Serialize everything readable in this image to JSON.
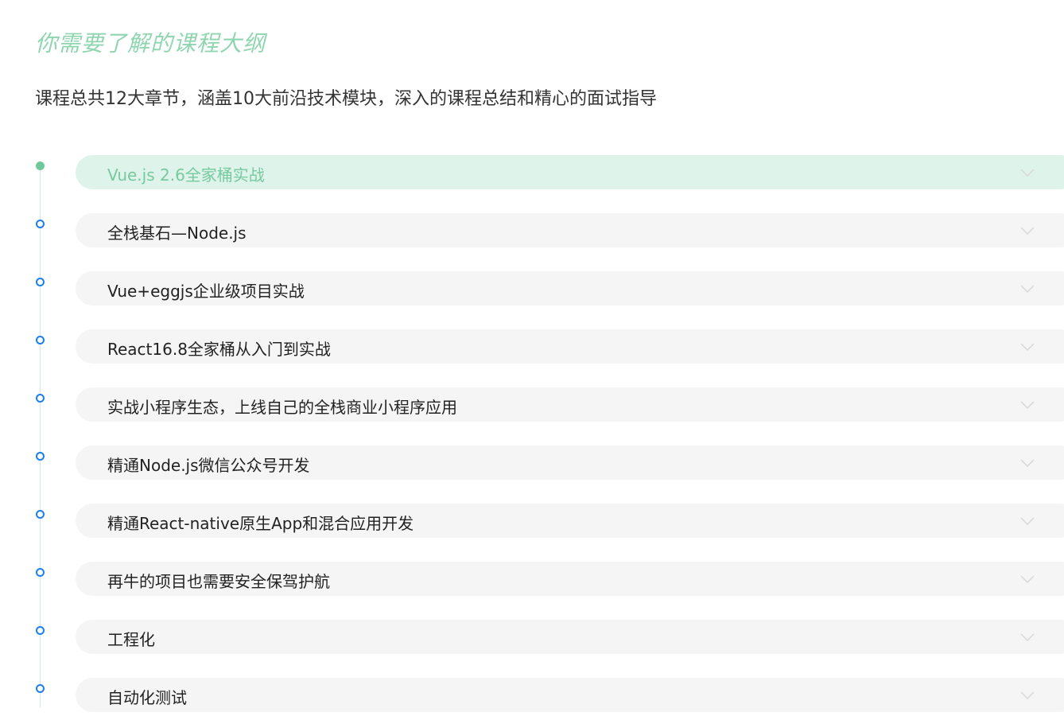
{
  "header": {
    "title": "你需要了解的课程大纲",
    "subtitle": "课程总共12大章节，涵盖10大前沿技术模块，深入的课程总结和精心的面试指导"
  },
  "chapters": [
    {
      "label": "Vue.js 2.6全家桶实战",
      "active": true
    },
    {
      "label": "全栈基石—Node.js",
      "active": false
    },
    {
      "label": "Vue+eggjs企业级项目实战",
      "active": false
    },
    {
      "label": "React16.8全家桶从入门到实战",
      "active": false
    },
    {
      "label": "实战小程序生态，上线自己的全栈商业小程序应用",
      "active": false
    },
    {
      "label": "精通Node.js微信公众号开发",
      "active": false
    },
    {
      "label": "精通React-native原生App和混合应用开发",
      "active": false
    },
    {
      "label": "再牛的项目也需要安全保驾护航",
      "active": false
    },
    {
      "label": "工程化",
      "active": false
    },
    {
      "label": "自动化测试",
      "active": false
    }
  ],
  "icons": {
    "expand": "chevron-down-icon",
    "timeline_dot": "circle-dot-icon"
  },
  "colors": {
    "accent": "#8fd6b0",
    "active_bar": "#def3ea",
    "active_text": "#77c9a0",
    "dot": "#1a7ff0",
    "bar": "#f5f5f5",
    "text": "#222222"
  }
}
